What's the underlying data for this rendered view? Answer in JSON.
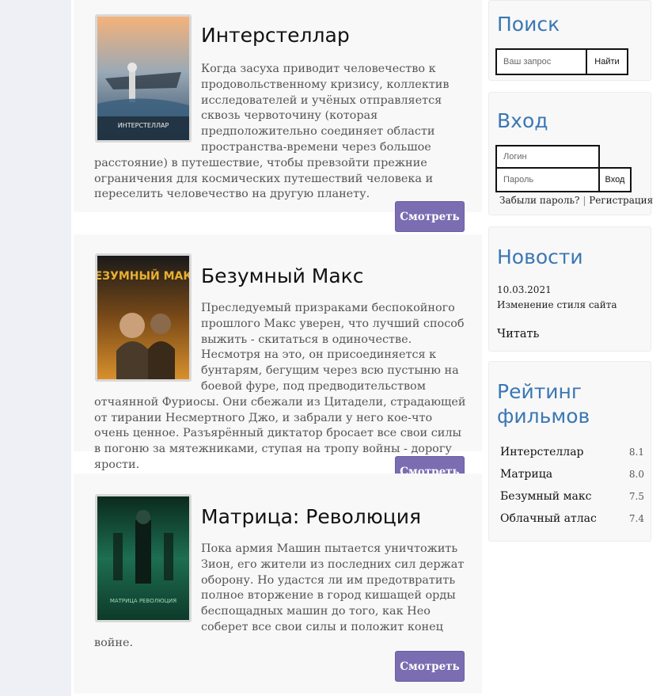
{
  "movies": [
    {
      "title": "Интерстеллар",
      "description": "Когда засуха приводит человечество к продовольственному кризису, коллектив исследователей и учёных отправляется сквозь червоточину (которая предположительно соединяет области пространства-времени через большое расстояние) в путешествие, чтобы превзойти прежние ограничения для космических путешествий человека и переселить человечество на другую планету.",
      "button": "Смотреть",
      "poster_text": "ИНТЕРСТЕЛЛАР"
    },
    {
      "title": "Безумный Макс",
      "description": "Преследуемый призраками беспокойного прошлого Макс уверен, что лучший способ выжить - скитаться в одиночестве. Несмотря на это, он присоединяется к бунтарям, бегущим через всю пустыню на боевой фуре, под предводительством отчаянной Фуриосы. Они сбежали из Цитадели, страдающей от тирании Несмертного Джо, и забрали у него кое-что очень ценное. Разъярённый диктатор бросает все свои силы в погоню за мятежниками, ступая на тропу войны - дорогу ярости.",
      "button": "Смотреть",
      "poster_text": "БЕЗУМНЫЙ МАКС"
    },
    {
      "title": "Матрица: Революция",
      "description": "Пока армия Машин пытается уничтожить Зион, его жители из последних сил держат оборону. Но удастся ли им предотвратить полное вторжение в город кишащей орды беспощадных машин до того, как Нео соберет все свои силы и положит конец войне.",
      "button": "Смотреть",
      "poster_text": "МАТРИЦА РЕВОЛЮЦИЯ"
    }
  ],
  "search": {
    "title": "Поиск",
    "placeholder": "Ваш запрос",
    "button": "Найти"
  },
  "login": {
    "title": "Вход",
    "login_placeholder": "Логин",
    "password_placeholder": "Пароль",
    "button": "Вход",
    "forgot": "Забыли пароль?",
    "separator": "|",
    "register": "Регистрация"
  },
  "news": {
    "title": "Новости",
    "date": "10.03.2021",
    "headline": "Изменение стиля сайта",
    "read": "Читать"
  },
  "rating": {
    "title_line1": "Рейтинг",
    "title_line2": "фильмов",
    "items": [
      {
        "name": "Интерстеллар",
        "value": "8.1"
      },
      {
        "name": "Матрица",
        "value": "8.0"
      },
      {
        "name": "Безумный макс",
        "value": "7.5"
      },
      {
        "name": "Облачный атлас",
        "value": "7.4"
      }
    ]
  },
  "colors": {
    "accent_button": "#7a6db2",
    "heading_blue": "#3a77b4",
    "page_bg": "#eef0f6"
  }
}
